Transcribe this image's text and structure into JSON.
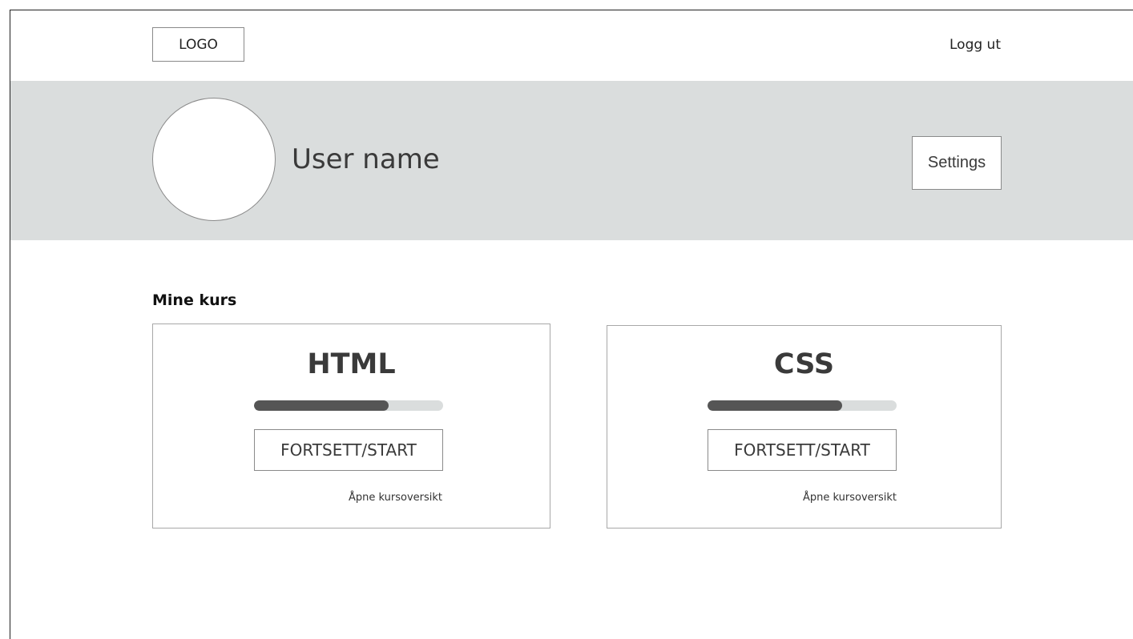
{
  "header": {
    "logo_text": "LOGO",
    "logout_label": "Logg ut"
  },
  "profile": {
    "user_name": "User name",
    "settings_label": "Settings"
  },
  "courses_section": {
    "title": "Mine kurs",
    "courses": [
      {
        "title": "HTML",
        "progress": 0.71,
        "button_label": "FORTSETT/START",
        "overview_link": "Åpne kursoversikt"
      },
      {
        "title": "CSS",
        "progress": 0.71,
        "button_label": "FORTSETT/START",
        "overview_link": "Åpne kursoversikt"
      }
    ]
  },
  "colors": {
    "band_background": "#dadddd",
    "progress_fill": "#555555",
    "progress_track": "#dadddd"
  }
}
